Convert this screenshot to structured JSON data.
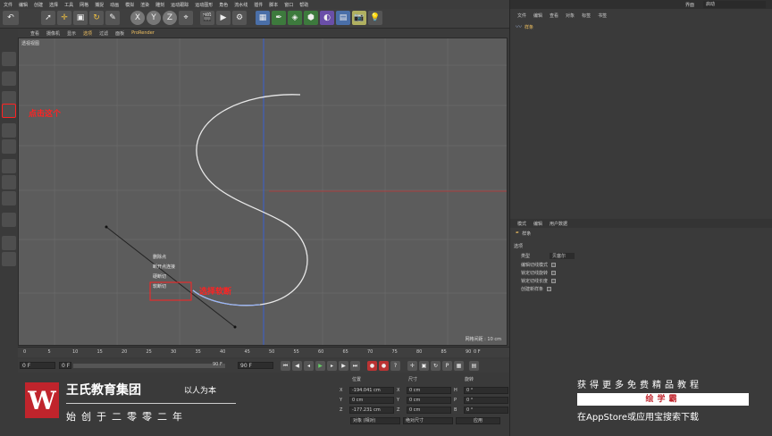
{
  "menubar": {
    "items": [
      "文件",
      "编辑",
      "创建",
      "选择",
      "工具",
      "网格",
      "捕捉",
      "动画",
      "模拟",
      "渲染",
      "雕刻",
      "运动跟踪",
      "运动图形",
      "角色",
      "流水线",
      "插件",
      "脚本",
      "窗口",
      "帮助"
    ]
  },
  "viewport": {
    "tabs": [
      "查看",
      "摄像机",
      "显示",
      "选项",
      "过滤",
      "面板",
      "ProRender"
    ],
    "label": "透视视图",
    "grid_info": "网格间距 : 10 cm"
  },
  "context_menu": {
    "items": [
      "删除点",
      "断开点连接",
      "硬断切",
      "软断切"
    ]
  },
  "annotations": {
    "left": "点击这个",
    "context": "选择软断"
  },
  "right_panel": {
    "layout_label": "界面",
    "layout_value": "启动",
    "obj_tabs": [
      "文件",
      "编辑",
      "查看",
      "对象",
      "标签",
      "书签"
    ],
    "obj_item": "样条",
    "attr_tabs": [
      "模式",
      "编辑",
      "用户数据"
    ],
    "attr_object": "样条",
    "attr_section": "选项",
    "type_label": "类型",
    "type_value": "贝塞尔",
    "options": [
      "编辑切线模式",
      "锁定切线旋转",
      "锁定切线长度",
      "创建新样条"
    ]
  },
  "timeline": {
    "ticks": [
      "0",
      "5",
      "10",
      "15",
      "20",
      "25",
      "30",
      "35",
      "40",
      "45",
      "50",
      "55",
      "60",
      "65",
      "70",
      "75",
      "80",
      "85",
      "90"
    ],
    "end_label": "0 F"
  },
  "transport": {
    "start_frame": "0 F",
    "current_frame": "0 F",
    "end_frame": "90 F",
    "end_frame_2": "90 F"
  },
  "coordinates": {
    "headers": [
      "位置",
      "尺寸",
      "旋转"
    ],
    "rows": [
      {
        "axis": "X",
        "pos": "-194.041 cm",
        "size": "0 cm",
        "rot_axis": "H",
        "rot": "0 °"
      },
      {
        "axis": "Y",
        "pos": "0 cm",
        "size": "0 cm",
        "rot_axis": "P",
        "rot": "0 °"
      },
      {
        "axis": "Z",
        "pos": "-177.231 cm",
        "size": "0 cm",
        "rot_axis": "B",
        "rot": "0 °"
      }
    ],
    "mode": "对象 (相对)",
    "size_mode": "绝对尺寸",
    "apply": "应用"
  },
  "watermark": {
    "company": "王氏教育集团",
    "slogan": "以人为本",
    "since": "始创于二零零二年",
    "right_top": "获得更多免费精品教程",
    "right_brand": "绘学霸",
    "right_bottom": "在AppStore或应用宝搜索下载"
  },
  "colors": {
    "accent_red": "#ff2222",
    "brand_red": "#c0242c",
    "spline": "#e8e8e8",
    "axis_blue": "#3a5fd0",
    "axis_red": "#c03030"
  }
}
